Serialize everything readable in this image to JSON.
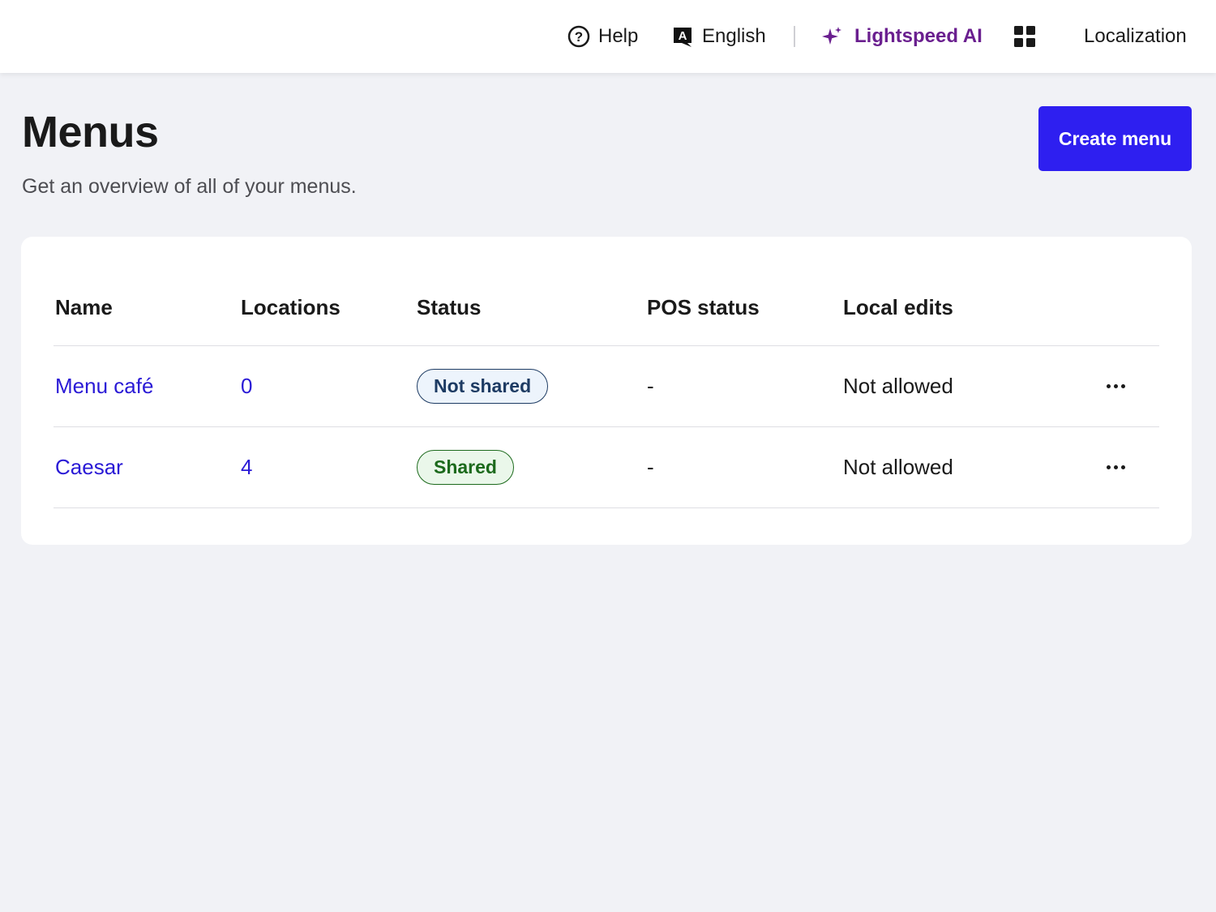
{
  "topbar": {
    "help_label": "Help",
    "language_label": "English",
    "ai_label": "Lightspeed AI",
    "localization_label": "Localization",
    "ai_color": "#6a1f8f"
  },
  "page": {
    "title": "Menus",
    "subtitle": "Get an overview of all of your menus.",
    "create_button_label": "Create menu",
    "accent_color": "#2e1ff0"
  },
  "table": {
    "columns": [
      "Name",
      "Locations",
      "Status",
      "POS status",
      "Local edits"
    ],
    "rows": [
      {
        "name": "Menu café",
        "locations": "0",
        "status": "Not shared",
        "pos_status": "-",
        "local_edits": "Not allowed"
      },
      {
        "name": "Caesar",
        "locations": "4",
        "status": "Shared",
        "pos_status": "-",
        "local_edits": "Not allowed"
      }
    ]
  },
  "icons": {
    "help": "question-circle-icon",
    "language": "translate-icon",
    "ai": "sparkle-icon",
    "apps": "grid-icon",
    "row_actions": "more-horizontal-icon"
  }
}
